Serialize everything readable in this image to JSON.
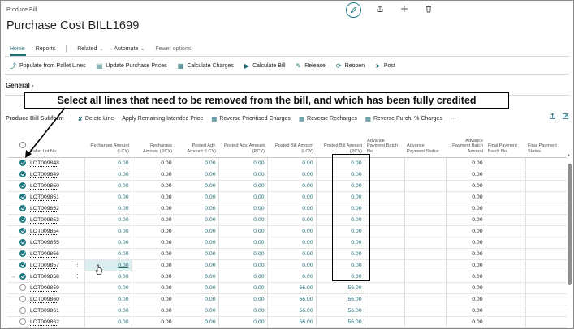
{
  "breadcrumb": "Produce Bill",
  "page_title": "Purchase Cost BILL1699",
  "top_icons": [
    "edit-icon",
    "share-icon",
    "add-icon",
    "delete-icon"
  ],
  "menu": {
    "home": "Home",
    "reports": "Reports",
    "related": "Related",
    "automate": "Automate",
    "fewer_options": "Fewer options"
  },
  "actions": [
    {
      "icon": "pallet-icon",
      "label": "Populate from Pallet Lines"
    },
    {
      "icon": "price-icon",
      "label": "Update Purchase Prices"
    },
    {
      "icon": "calculator-icon",
      "label": "Calculate Charges"
    },
    {
      "icon": "play-icon",
      "label": "Calculate Bill"
    },
    {
      "icon": "release-icon",
      "label": "Release"
    },
    {
      "icon": "reopen-icon",
      "label": "Reopen"
    },
    {
      "icon": "post-icon",
      "label": "Post"
    }
  ],
  "section_general": "General",
  "annotation": "Select all lines that need to be removed from the bill, and which has been fully credited",
  "subform": {
    "title": "Produce Bill Subform",
    "actions": [
      {
        "icon": "delete-line-icon",
        "label": "Delete Line"
      },
      {
        "icon": "",
        "label": "Apply Remaining Intended Price"
      },
      {
        "icon": "reverse-icon",
        "label": "Reverse Prioritised Charges"
      },
      {
        "icon": "reverse-icon",
        "label": "Reverse Recharges"
      },
      {
        "icon": "reverse-icon",
        "label": "Reverse Purch. % Charges"
      }
    ],
    "more": "···"
  },
  "columns": [
    "Pallet Lot No.",
    "Recharges Amount (LCY)",
    "Recharges Amount (PCY)",
    "Posted Adv. Amount (LCY)",
    "Posted Adv. Amount (PCY)",
    "Posted Bill Amount (LCY)",
    "Posted Bill Amount (PCY)",
    "Advance Payment Batch No.",
    "Advance Payment Status",
    "Advance Payment Batch Amount",
    "Final Payment Batch No.",
    "Final Payment Status"
  ],
  "rows": [
    {
      "lot": "LOT009848",
      "selected": true,
      "rech_lcy": "0.00",
      "rech_pcy": "0.00",
      "adv_lcy": "0.00",
      "adv_pcy": "0.00",
      "bill_lcy": "0.00",
      "bill_pcy": "0.00",
      "batch_amt": "0.00"
    },
    {
      "lot": "LOT009849",
      "selected": true,
      "rech_lcy": "0.00",
      "rech_pcy": "0.00",
      "adv_lcy": "0.00",
      "adv_pcy": "0.00",
      "bill_lcy": "0.00",
      "bill_pcy": "0.00",
      "batch_amt": "0.00"
    },
    {
      "lot": "LOT009850",
      "selected": true,
      "rech_lcy": "0.00",
      "rech_pcy": "0.00",
      "adv_lcy": "0.00",
      "adv_pcy": "0.00",
      "bill_lcy": "0.00",
      "bill_pcy": "0.00",
      "batch_amt": "0.00"
    },
    {
      "lot": "LOT009851",
      "selected": true,
      "rech_lcy": "0.00",
      "rech_pcy": "0.00",
      "adv_lcy": "0.00",
      "adv_pcy": "0.00",
      "bill_lcy": "0.00",
      "bill_pcy": "0.00",
      "batch_amt": "0.00"
    },
    {
      "lot": "LOT009852",
      "selected": true,
      "rech_lcy": "0.00",
      "rech_pcy": "0.00",
      "adv_lcy": "0.00",
      "adv_pcy": "0.00",
      "bill_lcy": "0.00",
      "bill_pcy": "0.00",
      "batch_amt": "0.00"
    },
    {
      "lot": "LOT009853",
      "selected": true,
      "rech_lcy": "0.00",
      "rech_pcy": "0.00",
      "adv_lcy": "0.00",
      "adv_pcy": "0.00",
      "bill_lcy": "0.00",
      "bill_pcy": "0.00",
      "batch_amt": "0.00"
    },
    {
      "lot": "LOT009854",
      "selected": true,
      "rech_lcy": "0.00",
      "rech_pcy": "0.00",
      "adv_lcy": "0.00",
      "adv_pcy": "0.00",
      "bill_lcy": "0.00",
      "bill_pcy": "0.00",
      "batch_amt": "0.00"
    },
    {
      "lot": "LOT009855",
      "selected": true,
      "rech_lcy": "0.00",
      "rech_pcy": "0.00",
      "adv_lcy": "0.00",
      "adv_pcy": "0.00",
      "bill_lcy": "0.00",
      "bill_pcy": "0.00",
      "batch_amt": "0.00"
    },
    {
      "lot": "LOT009856",
      "selected": true,
      "rech_lcy": "0.00",
      "rech_pcy": "0.00",
      "adv_lcy": "0.00",
      "adv_pcy": "0.00",
      "bill_lcy": "0.00",
      "bill_pcy": "0.00",
      "batch_amt": "0.00"
    },
    {
      "lot": "LOT009857",
      "selected": true,
      "rech_lcy": "0.00",
      "rech_pcy": "0.00",
      "adv_lcy": "0.00",
      "adv_pcy": "0.00",
      "bill_lcy": "0.00",
      "bill_pcy": "0.00",
      "batch_amt": "0.00",
      "menu": true,
      "focused": true
    },
    {
      "lot": "LOT009858",
      "selected": true,
      "rech_lcy": "0.00",
      "rech_pcy": "0.00",
      "adv_lcy": "0.00",
      "adv_pcy": "0.00",
      "bill_lcy": "0.00",
      "bill_pcy": "0.00",
      "batch_amt": "0.00",
      "menu": true,
      "current": true
    },
    {
      "lot": "LOT009859",
      "selected": false,
      "rech_lcy": "0.00",
      "rech_pcy": "0.00",
      "adv_lcy": "0.00",
      "adv_pcy": "0.00",
      "bill_lcy": "56.00",
      "bill_pcy": "56.00",
      "batch_amt": "0.00"
    },
    {
      "lot": "LOT009860",
      "selected": false,
      "rech_lcy": "0.00",
      "rech_pcy": "0.00",
      "adv_lcy": "0.00",
      "adv_pcy": "0.00",
      "bill_lcy": "56.00",
      "bill_pcy": "56.00",
      "batch_amt": "0.00"
    },
    {
      "lot": "LOT009861",
      "selected": false,
      "rech_lcy": "0.00",
      "rech_pcy": "0.00",
      "adv_lcy": "0.00",
      "adv_pcy": "0.00",
      "bill_lcy": "56.00",
      "bill_pcy": "56.00",
      "batch_amt": "0.00"
    },
    {
      "lot": "LOT009862",
      "selected": false,
      "rech_lcy": "0.00",
      "rech_pcy": "0.00",
      "adv_lcy": "0.00",
      "adv_pcy": "0.00",
      "bill_lcy": "56.00",
      "bill_pcy": "56.00",
      "batch_amt": "0.00"
    }
  ],
  "colors": {
    "accent": "#1e7b82",
    "link": "#1e6e78",
    "focus_cell": "#dbeef0",
    "annotation_border": "#000000"
  }
}
